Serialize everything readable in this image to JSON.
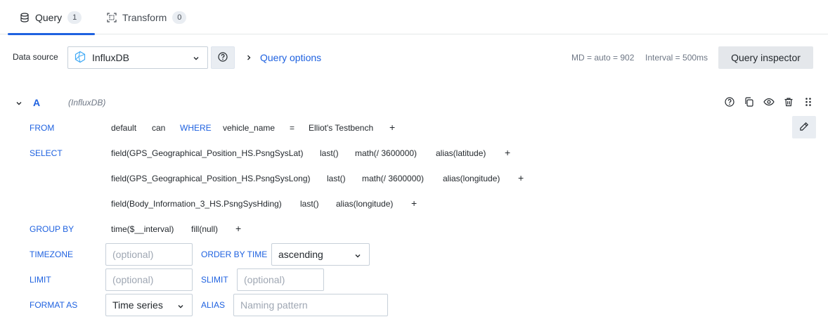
{
  "tabs": [
    {
      "label": "Query",
      "count": "1"
    },
    {
      "label": "Transform",
      "count": "0"
    }
  ],
  "datasource": {
    "label": "Data source",
    "selected": "InfluxDB"
  },
  "query_options": {
    "label": "Query options",
    "md": "MD = auto = 902",
    "interval": "Interval = 500ms"
  },
  "inspector": {
    "label": "Query inspector"
  },
  "query": {
    "ref_id": "A",
    "datasource_hint": "(InfluxDB)",
    "from": {
      "keyword": "FROM",
      "policy": "default",
      "measurement": "can",
      "where_keyword": "WHERE",
      "where_key": "vehicle_name",
      "where_op": "=",
      "where_value": "Elliot's Testbench",
      "plus": "+"
    },
    "select": {
      "keyword": "SELECT",
      "rows": [
        {
          "field": "field(GPS_Geographical_Position_HS.PsngSysLat)",
          "agg": "last()",
          "math": "math(/ 3600000)",
          "alias": "alias(latitude)",
          "plus": "+"
        },
        {
          "field": "field(GPS_Geographical_Position_HS.PsngSysLong)",
          "agg": "last()",
          "math": "math(/ 3600000)",
          "alias": "alias(longitude)",
          "plus": "+"
        },
        {
          "field": "field(Body_Information_3_HS.PsngSysHding)",
          "agg": "last()",
          "alias": "alias(longitude)",
          "plus": "+"
        }
      ]
    },
    "group_by": {
      "keyword": "GROUP BY",
      "time": "time($__interval)",
      "fill": "fill(null)",
      "plus": "+"
    },
    "timezone": {
      "keyword": "TIMEZONE",
      "placeholder": "(optional)"
    },
    "order_by_time": {
      "keyword": "ORDER BY TIME",
      "value": "ascending"
    },
    "limit": {
      "keyword": "LIMIT",
      "placeholder": "(optional)"
    },
    "slimit": {
      "keyword": "SLIMIT",
      "placeholder": "(optional)"
    },
    "format_as": {
      "keyword": "FORMAT AS",
      "value": "Time series"
    },
    "alias": {
      "keyword": "ALIAS",
      "placeholder": "Naming pattern"
    }
  },
  "colors": {
    "accent": "#1f62e0",
    "text": "#24292e",
    "muted": "#6e7785",
    "border": "#c7d0d9",
    "button_bg": "#e4e7eb"
  },
  "icons": {
    "query_tab": "database-icon",
    "transform_tab": "transform-icon",
    "datasource": "influxdb-icon",
    "help": "question-circle-icon",
    "chevron": "chevron-down-icon",
    "expand": "chevron-right-icon",
    "collapse": "chevron-down-icon",
    "actions": [
      "question-circle-icon",
      "copy-icon",
      "eye-icon",
      "trash-icon",
      "drag-handle-icon"
    ],
    "edit": "pencil-icon"
  }
}
